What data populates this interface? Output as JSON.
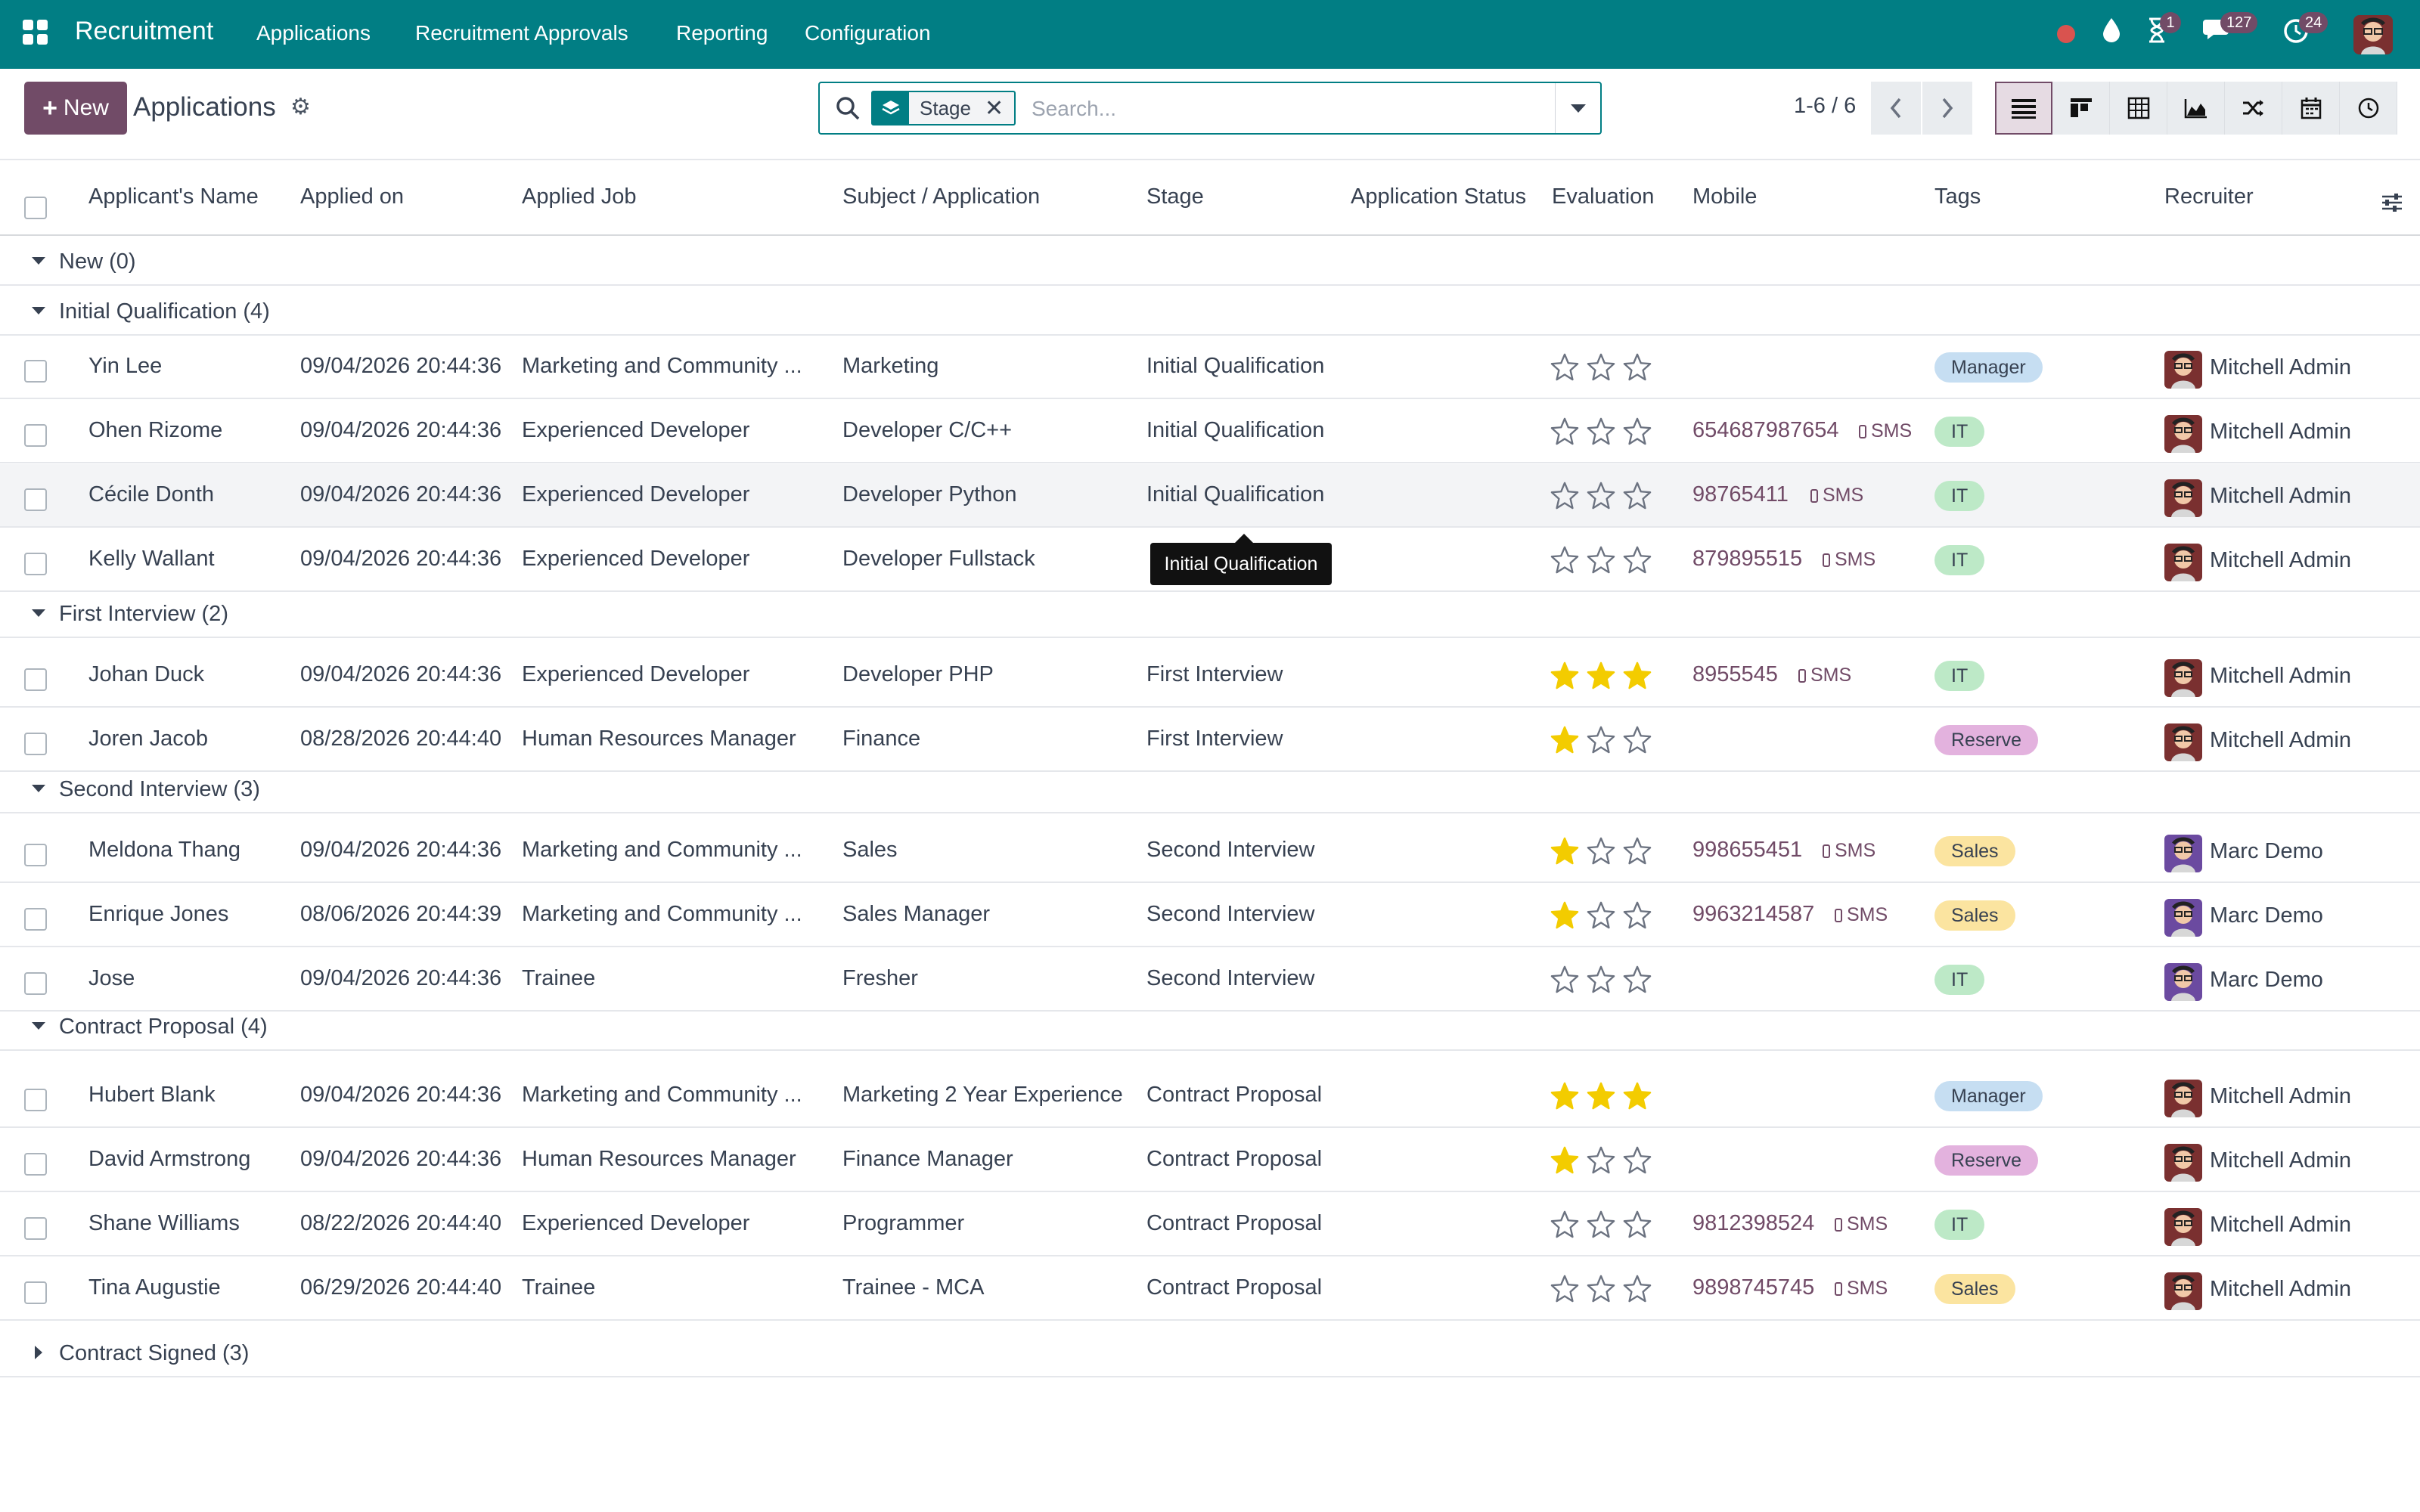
{
  "nav": {
    "brand": "Recruitment",
    "menu": [
      "Applications",
      "Recruitment Approvals",
      "Reporting",
      "Configuration"
    ],
    "badges": {
      "activities": "1",
      "messages": "127",
      "timer": "24"
    }
  },
  "control": {
    "new_label": "New",
    "title": "Applications",
    "facet_label": "Stage",
    "search_placeholder": "Search...",
    "pager": "1-6 / 6"
  },
  "columns": [
    "Applicant's Name",
    "Applied on",
    "Applied Job",
    "Subject / Application",
    "Stage",
    "Application Status",
    "Evaluation",
    "Mobile",
    "Tags",
    "Recruiter"
  ],
  "groups": [
    {
      "label": "New (0)",
      "open": true,
      "rows": []
    },
    {
      "label": "Initial Qualification (4)",
      "open": true,
      "rows": [
        {
          "name": "Yin Lee",
          "applied": "09/04/2026 20:44:36",
          "job": "Marketing and Community ...",
          "subject": "Marketing",
          "stage": "Initial Qualification",
          "stars": 0,
          "mobile": "",
          "tag": "Manager",
          "tag_color": "manager",
          "recruiter": "Mitchell Admin"
        },
        {
          "name": "Ohen Rizome",
          "applied": "09/04/2026 20:44:36",
          "job": "Experienced Developer",
          "subject": "Developer C/C++",
          "stage": "Initial Qualification",
          "stars": 0,
          "mobile": "654687987654",
          "tag": "IT",
          "tag_color": "it",
          "recruiter": "Mitchell Admin"
        },
        {
          "name": "Cécile Donth",
          "applied": "09/04/2026 20:44:36",
          "job": "Experienced Developer",
          "subject": "Developer Python",
          "stage": "Initial Qualification",
          "stars": 0,
          "mobile": "98765411",
          "tag": "IT",
          "tag_color": "it",
          "recruiter": "Mitchell Admin",
          "highlight": true
        },
        {
          "name": "Kelly Wallant",
          "applied": "09/04/2026 20:44:36",
          "job": "Experienced Developer",
          "subject": "Developer Fullstack",
          "stage": "",
          "stars": 0,
          "mobile": "879895515",
          "tag": "IT",
          "tag_color": "it",
          "recruiter": "Mitchell Admin"
        }
      ]
    },
    {
      "label": "First Interview (2)",
      "open": true,
      "rows": [
        {
          "name": "Johan Duck",
          "applied": "09/04/2026 20:44:36",
          "job": "Experienced Developer",
          "subject": "Developer PHP",
          "stage": "First Interview",
          "stars": 3,
          "mobile": "8955545",
          "tag": "IT",
          "tag_color": "it",
          "recruiter": "Mitchell Admin"
        },
        {
          "name": "Joren Jacob",
          "applied": "08/28/2026 20:44:40",
          "job": "Human Resources Manager",
          "subject": "Finance",
          "stage": "First Interview",
          "stars": 1,
          "mobile": "",
          "tag": "Reserve",
          "tag_color": "reserve",
          "recruiter": "Mitchell Admin"
        }
      ]
    },
    {
      "label": "Second Interview (3)",
      "open": true,
      "rows": [
        {
          "name": "Meldona Thang",
          "applied": "09/04/2026 20:44:36",
          "job": "Marketing and Community ...",
          "subject": "Sales",
          "stage": "Second Interview",
          "stars": 1,
          "mobile": "998655451",
          "tag": "Sales",
          "tag_color": "sales",
          "recruiter": "Marc Demo"
        },
        {
          "name": "Enrique Jones",
          "applied": "08/06/2026 20:44:39",
          "job": "Marketing and Community ...",
          "subject": "Sales Manager",
          "stage": "Second Interview",
          "stars": 1,
          "mobile": "9963214587",
          "tag": "Sales",
          "tag_color": "sales",
          "recruiter": "Marc Demo"
        },
        {
          "name": "Jose",
          "applied": "09/04/2026 20:44:36",
          "job": "Trainee",
          "subject": "Fresher",
          "stage": "Second Interview",
          "stars": 0,
          "mobile": "",
          "tag": "IT",
          "tag_color": "it",
          "recruiter": "Marc Demo"
        }
      ]
    },
    {
      "label": "Contract Proposal (4)",
      "open": true,
      "rows": [
        {
          "name": "Hubert Blank",
          "applied": "09/04/2026 20:44:36",
          "job": "Marketing and Community ...",
          "subject": "Marketing 2 Year Experience",
          "stage": "Contract Proposal",
          "stars": 3,
          "mobile": "",
          "tag": "Manager",
          "tag_color": "manager",
          "recruiter": "Mitchell Admin"
        },
        {
          "name": "David Armstrong",
          "applied": "09/04/2026 20:44:36",
          "job": "Human Resources Manager",
          "subject": "Finance Manager",
          "stage": "Contract Proposal",
          "stars": 1,
          "mobile": "",
          "tag": "Reserve",
          "tag_color": "reserve",
          "recruiter": "Mitchell Admin"
        },
        {
          "name": "Shane Williams",
          "applied": "08/22/2026 20:44:40",
          "job": "Experienced Developer",
          "subject": "Programmer",
          "stage": "Contract Proposal",
          "stars": 0,
          "mobile": "9812398524",
          "tag": "IT",
          "tag_color": "it",
          "recruiter": "Mitchell Admin"
        },
        {
          "name": "Tina Augustie",
          "applied": "06/29/2026 20:44:40",
          "job": "Trainee",
          "subject": "Trainee - MCA",
          "stage": "Contract Proposal",
          "stars": 0,
          "mobile": "9898745745",
          "tag": "Sales",
          "tag_color": "sales",
          "recruiter": "Mitchell Admin"
        }
      ]
    },
    {
      "label": "Contract Signed (3)",
      "open": false,
      "rows": []
    }
  ],
  "sms_label": "SMS",
  "tooltip": "Initial Qualification",
  "colors": {
    "brand": "#017e84",
    "primary": "#714b67",
    "star": "#f3cc00"
  }
}
